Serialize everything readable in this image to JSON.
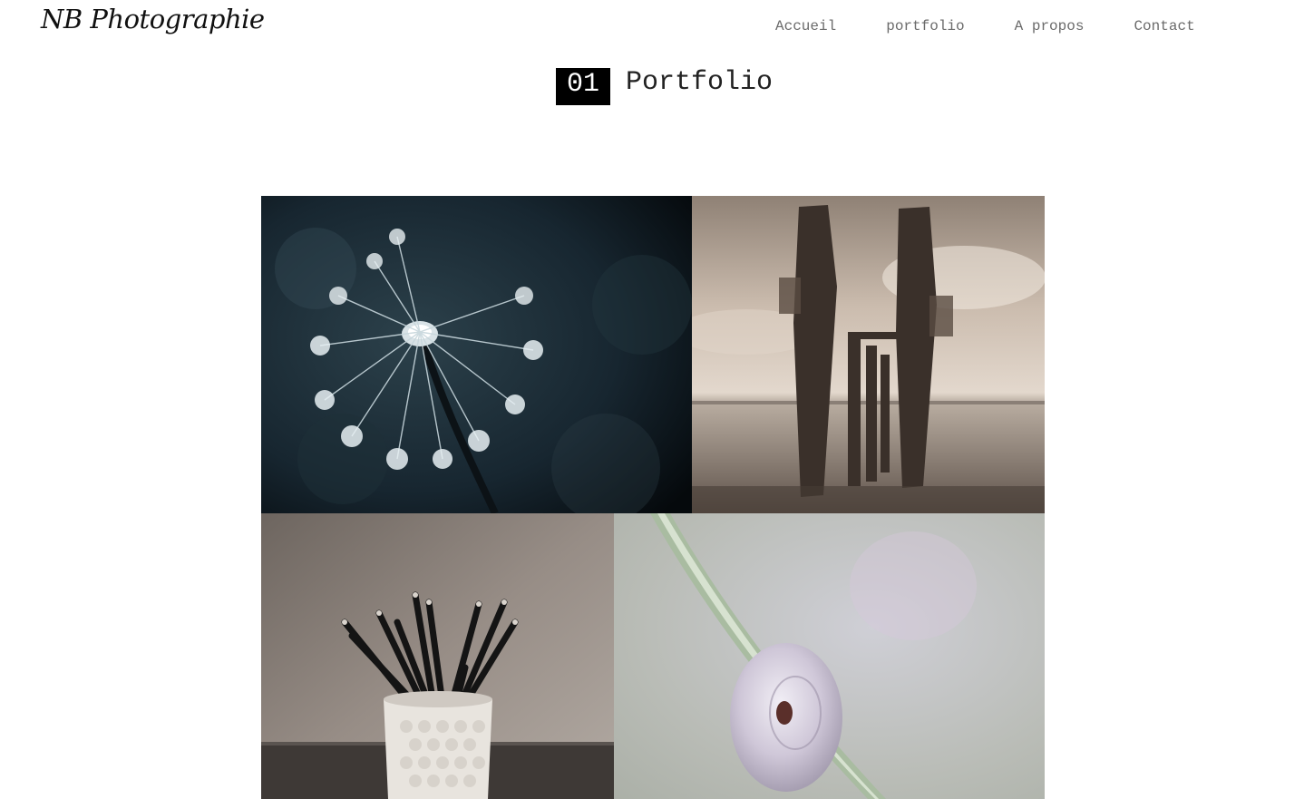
{
  "site": {
    "logo": "NB Photographie"
  },
  "nav": {
    "items": [
      {
        "label": "Accueil"
      },
      {
        "label": "portfolio"
      },
      {
        "label": "A propos"
      },
      {
        "label": "Contact"
      }
    ]
  },
  "section": {
    "number": "01",
    "title": "Portfolio"
  },
  "gallery": {
    "photos": [
      {
        "subject": "dandelion seed head"
      },
      {
        "subject": "weathered wooden pier posts on beach"
      },
      {
        "subject": "pencils in a white cup"
      },
      {
        "subject": "snail shell on grass blade"
      }
    ]
  }
}
